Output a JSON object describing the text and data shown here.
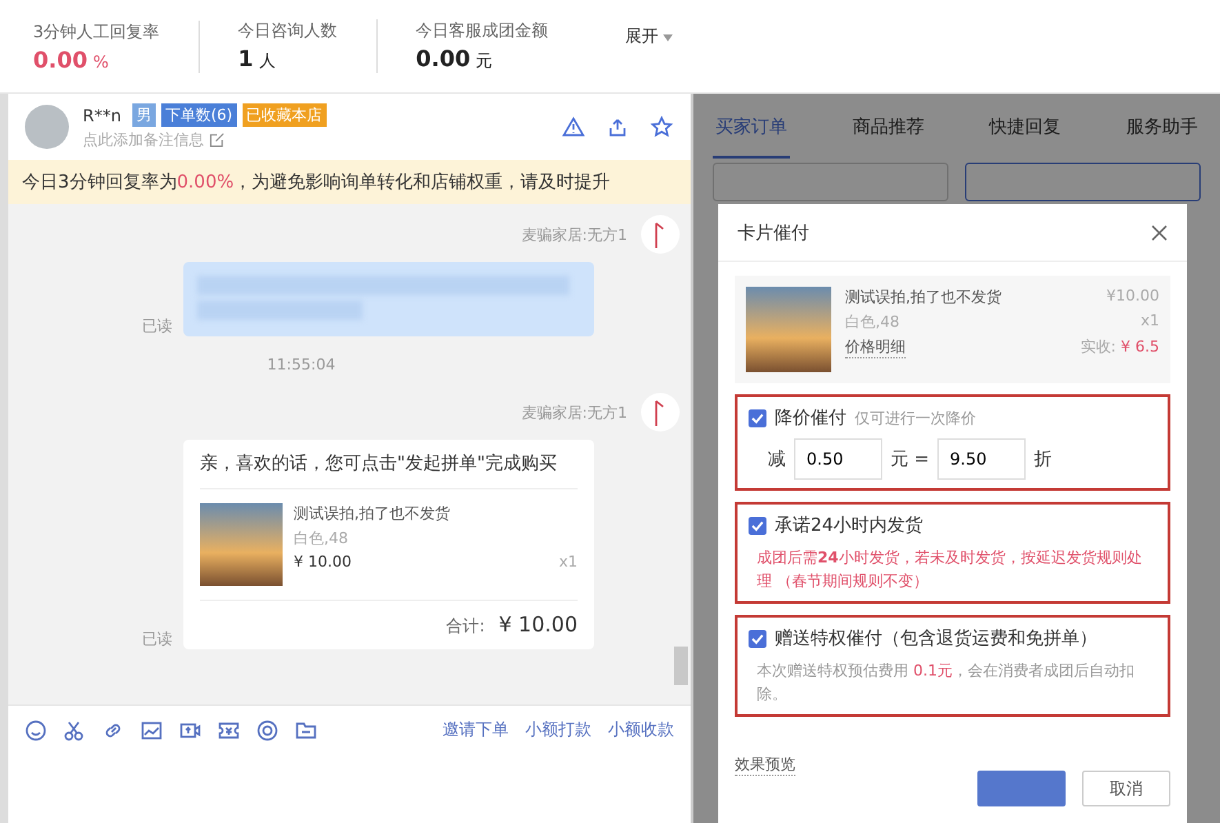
{
  "stats": [
    {
      "label": "3分钟人工回复率",
      "value": "0.00",
      "unit": "%",
      "kind": "alert"
    },
    {
      "label": "今日咨询人数",
      "value": "1",
      "unit": "人",
      "kind": "normal"
    },
    {
      "label": "今日客服成团金额",
      "value": "0.00",
      "unit": "元",
      "kind": "normal"
    }
  ],
  "expand": "展开",
  "contact": {
    "name": "R**n",
    "tags": [
      {
        "text": "男",
        "color": "#7aa7e0"
      },
      {
        "text": "下单数(6)",
        "color": "#4a7fd8"
      },
      {
        "text": "已收藏本店",
        "color": "#f0a020"
      }
    ],
    "note_hint": "点此添加备注信息"
  },
  "notice": {
    "before": "今日3分钟回复率为 ",
    "highlight": "0.00%",
    "after": " ，为避免影响询单转化和店铺权重，请及时提升"
  },
  "messages": [
    {
      "kind": "sender",
      "text": "麦骗家居:无方1"
    },
    {
      "kind": "blurred",
      "status": "已读"
    },
    {
      "kind": "time",
      "text": "11:55:04"
    },
    {
      "kind": "sender",
      "text": "麦骗家居:无方1"
    },
    {
      "kind": "card",
      "status": "已读",
      "text": "亲，喜欢的话，您可点击\"发起拼单\"完成购买",
      "product": {
        "title": "测试误拍,拍了也不发货",
        "spec": "白色,48",
        "price": "¥ 10.00",
        "qty": "x1"
      },
      "total_label": "合计:",
      "total": "¥ 10.00"
    }
  ],
  "toolbar_links": [
    "邀请下单",
    "小额打款",
    "小额收款"
  ],
  "tabs": [
    {
      "label": "买家订单",
      "selected": true
    },
    {
      "label": "商品推荐",
      "selected": false
    },
    {
      "label": "快捷回复",
      "selected": false
    },
    {
      "label": "服务助手",
      "selected": false
    }
  ],
  "dialog": {
    "title": "卡片催付",
    "product": {
      "title": "测试误拍,拍了也不发货",
      "spec": "白色,48",
      "detail_link": "价格明细",
      "price": "¥10.00",
      "qty": "x1",
      "received_label": "实收:",
      "received": "¥ 6.5"
    },
    "options": [
      {
        "kind": "discount",
        "checked": true,
        "title": "降价催付",
        "hint": "仅可进行一次降价",
        "prefix": "减",
        "amount": "0.50",
        "unit": "元 =",
        "rate": "9.50",
        "rate_unit": "折"
      },
      {
        "kind": "promise",
        "checked": true,
        "title": "承诺24小时内发货",
        "desc": "成团后需**24**小时发货，若未及时发货，按延迟发货规则处理 （春节期间规则不变）"
      },
      {
        "kind": "privilege",
        "checked": true,
        "title": "赠送特权催付（包含退货运费和免拼单）",
        "desc_before": "本次赠送特权预估费用 ",
        "desc_highlight": "0.1元",
        "desc_after": "，会在消费者成团后自动扣除。"
      }
    ],
    "preview_link": "效果预览",
    "cancel": "取消"
  }
}
